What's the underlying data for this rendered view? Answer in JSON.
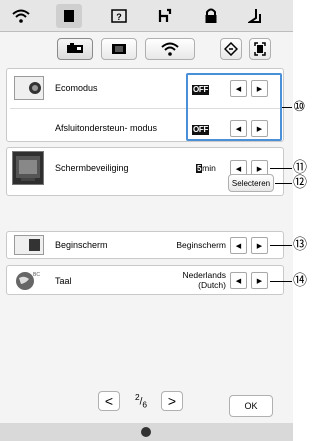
{
  "header": {
    "tabs": [
      {
        "name": "wifi-icon",
        "glyph": "≋"
      },
      {
        "name": "page-icon",
        "glyph": "■"
      },
      {
        "name": "help-icon",
        "glyph": "?"
      },
      {
        "name": "thread-icon",
        "glyph": "⌂"
      },
      {
        "name": "lock-icon",
        "glyph": "⊓"
      },
      {
        "name": "presser-foot-icon",
        "glyph": "⊿"
      }
    ]
  },
  "settings": {
    "eco_mode": {
      "label": "Ecomodus",
      "value": "OFF"
    },
    "shutoff_support": {
      "label": "Afsluitondersteun- modus",
      "value": "OFF"
    },
    "screensaver": {
      "label": "Schermbeveiliging",
      "value_num": "5",
      "value_unit": "min",
      "select_label": "Selecteren"
    },
    "home_screen": {
      "label": "Beginscherm",
      "value": "Beginscherm"
    },
    "language": {
      "label": "Taal",
      "value_line1": "Nederlands",
      "value_line2": "(Dutch)"
    }
  },
  "arrows": {
    "left": "◀",
    "right": "▶"
  },
  "pager": {
    "prev": "<",
    "next": ">",
    "current": "2",
    "total": "6"
  },
  "ok_label": "OK",
  "callouts": {
    "c10": "⑩",
    "c11": "⑪",
    "c12": "⑫",
    "c13": "⑬",
    "c14": "⑭"
  },
  "colors": {
    "highlight_border": "#4a90d9"
  }
}
